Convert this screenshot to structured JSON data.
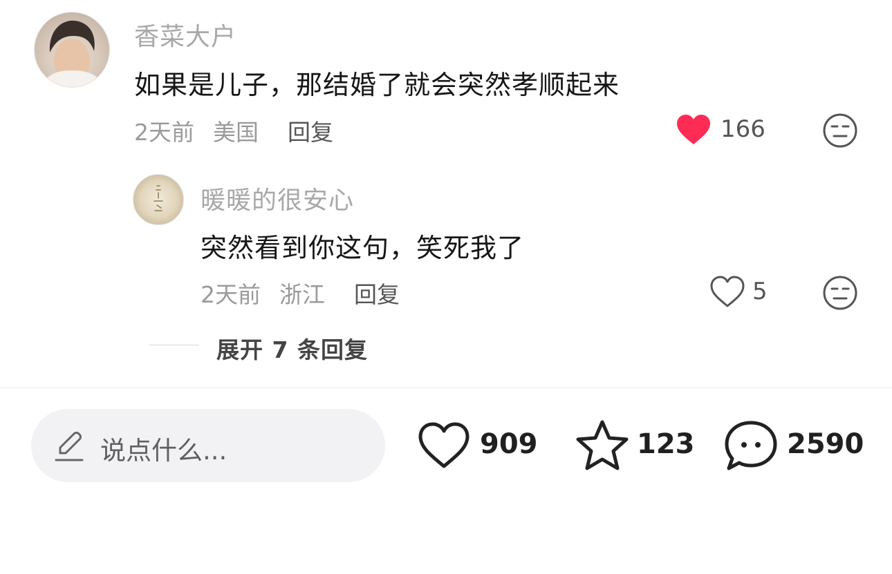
{
  "comment": {
    "username": "香菜大户",
    "text": "如果是儿子，那结婚了就会突然孝顺起来",
    "time": "2天前",
    "location": "美国",
    "reply_label": "回复",
    "like_count": "166",
    "liked": true,
    "like_color": "#fe2c55"
  },
  "reply": {
    "username": "暖暖的很安心",
    "text": "突然看到你这句，笑死我了",
    "time": "2天前",
    "location": "浙江",
    "reply_label": "回复",
    "like_count": "5",
    "liked": false
  },
  "expand_replies": "展开 7 条回复",
  "bottom_bar": {
    "input_placeholder": "说点什么...",
    "like_count": "909",
    "favorite_count": "123",
    "comment_count": "2590"
  },
  "icons": {
    "comment_like": "heart-filled-icon",
    "dislike": "unamused-face-icon",
    "reply_like": "heart-outline-icon",
    "edit": "pencil-icon",
    "bottom_like": "heart-outline-icon",
    "bottom_favorite": "star-outline-icon",
    "bottom_comment": "chat-bubble-icon"
  }
}
